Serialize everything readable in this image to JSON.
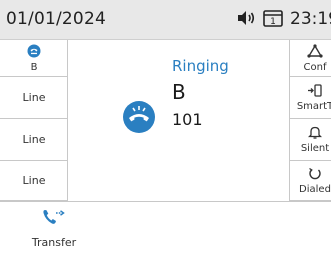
{
  "status_bar": {
    "date": "01/01/2024",
    "time": "23:19",
    "icons": [
      "speaker-volume-icon",
      "voicemail-icon"
    ]
  },
  "line_keys": [
    {
      "label": "B",
      "icon": "user-call-icon"
    },
    {
      "label": "Line"
    },
    {
      "label": "Line"
    },
    {
      "label": "Line"
    }
  ],
  "soft_keys": [
    {
      "label": "Conf",
      "icon": "conference-icon"
    },
    {
      "label": "SmartT",
      "icon": "smart-transfer-icon"
    },
    {
      "label": "Silent",
      "icon": "bell-icon"
    },
    {
      "label": "Dialed",
      "icon": "redial-icon"
    }
  ],
  "call": {
    "status": "Ringing",
    "name": "B",
    "number": "101",
    "icon": "incoming-call-icon"
  },
  "bottom": {
    "transfer_label": "Transfer",
    "icon": "call-transfer-icon"
  },
  "colors": {
    "accent": "#2a7fc1",
    "status_bar_bg": "#e8e8e8",
    "divider": "#c8c8c8"
  }
}
